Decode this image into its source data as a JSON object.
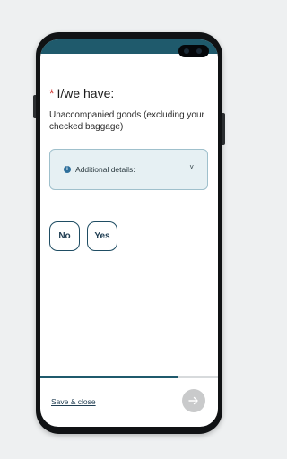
{
  "question": {
    "required_mark": "*",
    "title": "I/we have:"
  },
  "subtitle": "Unaccompanied goods (excluding your checked baggage)",
  "details": {
    "info_glyph": "i",
    "label": "Additional details:",
    "chevron": "˅"
  },
  "choices": {
    "no": "No",
    "yes": "Yes"
  },
  "footer": {
    "save_close": "Save & close",
    "next_icon": "arrow-right-icon",
    "progress": 0.78
  },
  "colors": {
    "accent": "#1f5a6c",
    "required": "#d0312d",
    "panel_bg": "#e6f0f3",
    "panel_border": "#9fc0cc"
  }
}
